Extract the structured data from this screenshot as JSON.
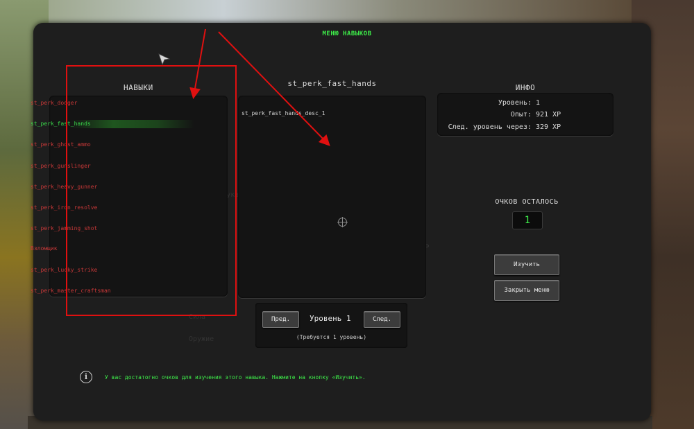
{
  "title": "МЕНЮ НАВЫКОВ",
  "skills": {
    "header": "НАВЫКИ",
    "items": [
      {
        "label": "st_perk_dodger",
        "selected": false
      },
      {
        "label": "st_perk_fast_hands",
        "selected": true
      },
      {
        "label": "st_perk_ghost_ammo",
        "selected": false
      },
      {
        "label": "st_perk_gunslinger",
        "selected": false
      },
      {
        "label": "st_perk_heavy_gunner",
        "selected": false
      },
      {
        "label": "st_perk_iron_resolve",
        "selected": false
      },
      {
        "label": "st_perk_jamming_shot",
        "selected": false
      },
      {
        "label": "Взломщик",
        "selected": false
      },
      {
        "label": "st_perk_lucky_strike",
        "selected": false
      },
      {
        "label": "st_perk_master_craftsman",
        "selected": false
      }
    ]
  },
  "detail": {
    "header": "st_perk_fast_hands",
    "description": "st_perk_fast_hands_desc_1"
  },
  "info": {
    "header": "ИНФО",
    "level_label": "Уровень:",
    "level_value": "1",
    "xp_label": "Опыт:",
    "xp_value": "921 XP",
    "next_label": "След. уровень через:",
    "next_value": "329 XP"
  },
  "points": {
    "label": "ОЧКОВ ОСТАЛОСЬ",
    "value": "1"
  },
  "buttons": {
    "learn": "Изучить",
    "close": "Закрыть меню",
    "prev": "Пред.",
    "next": "След."
  },
  "level_nav": {
    "level_text": "Уровень 1",
    "requirement": "(Требуется 1 уровень)"
  },
  "hint": "У вас достатогно очков для изучения этого навыка. Нажмите на кнопку «Изучить».",
  "colors": {
    "accent_green": "#3ef04a",
    "skill_red": "#c83838",
    "annotation_red": "#e01010"
  }
}
